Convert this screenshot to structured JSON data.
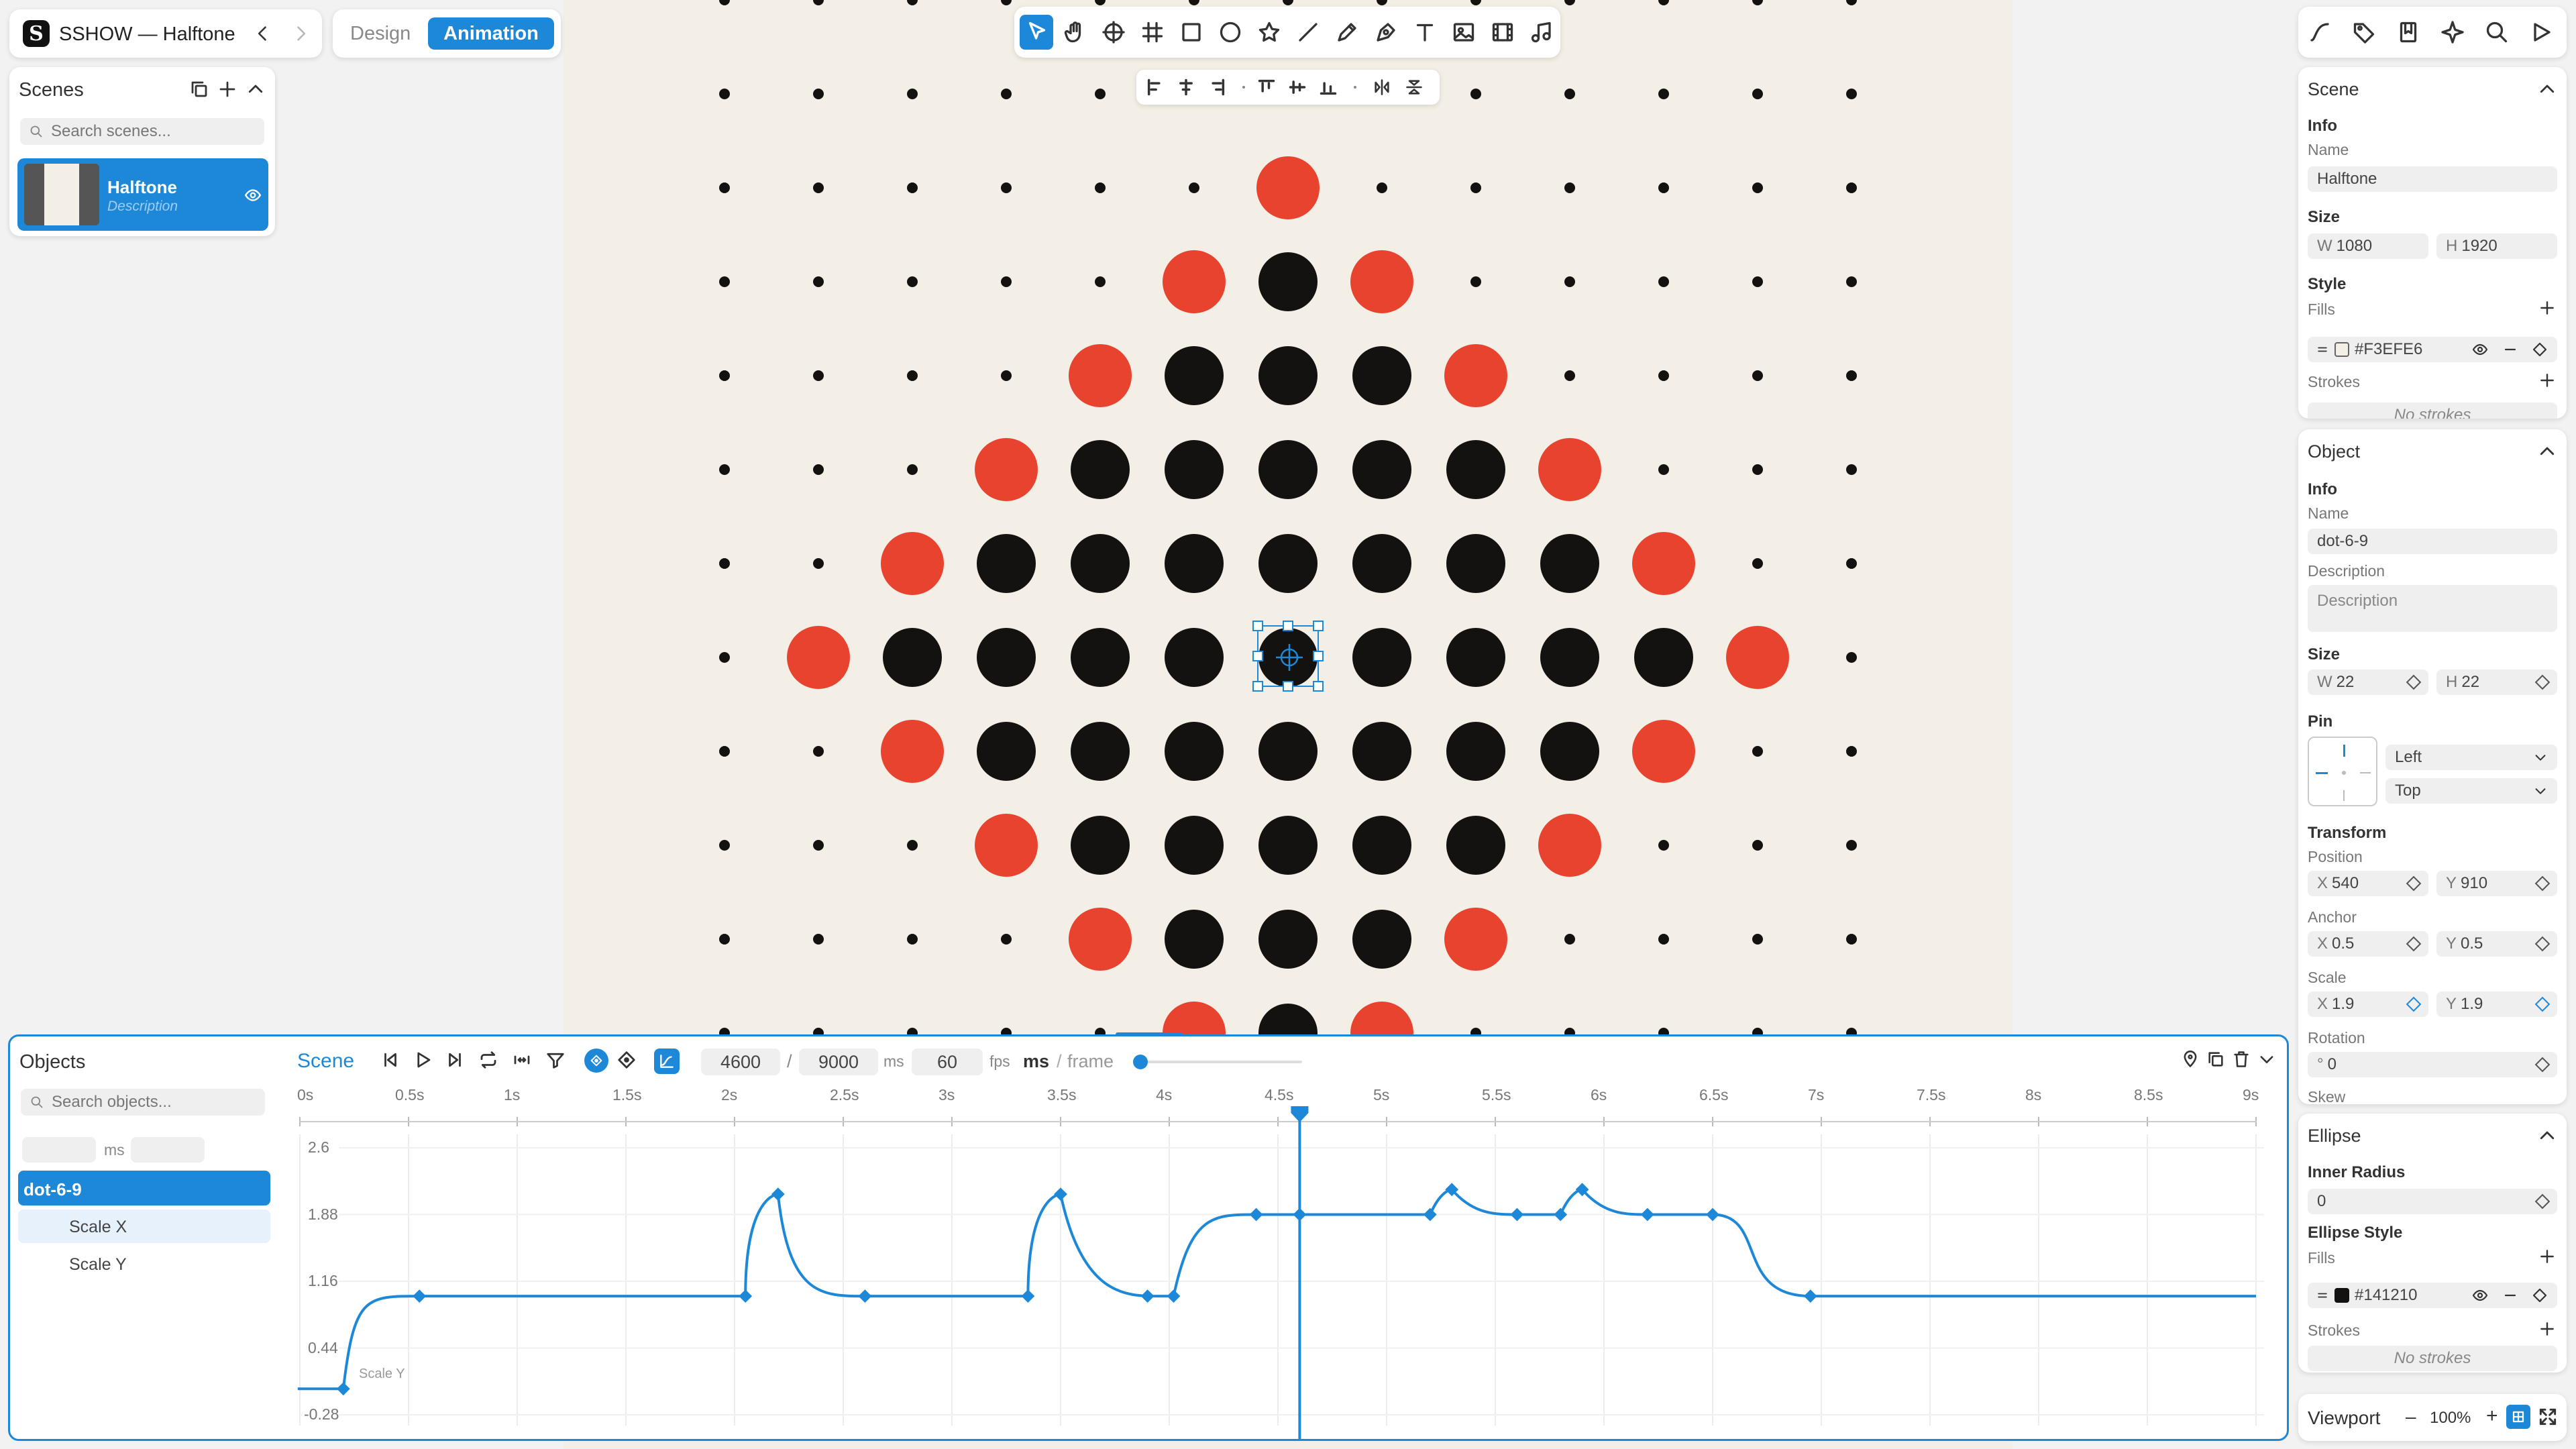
{
  "app": {
    "title": "SSHOW — Halftone"
  },
  "modes": {
    "design": "Design",
    "animation": "Animation"
  },
  "scenes": {
    "title": "Scenes",
    "search_placeholder": "Search scenes...",
    "items": [
      {
        "name": "Halftone",
        "description": "Description"
      }
    ]
  },
  "canvas": {
    "background": "#F3EFE6",
    "red": "#E8432F",
    "black": "#141210"
  },
  "right": {
    "scene": {
      "title": "Scene",
      "info": "Info",
      "name_label": "Name",
      "name": "Halftone",
      "size": "Size",
      "w": "1080",
      "h": "1920",
      "w_pre": "W",
      "h_pre": "H",
      "style": "Style",
      "fills": "Fills",
      "fill_hex": "#F3EFE6",
      "strokes": "Strokes",
      "no_strokes": "No strokes"
    },
    "object": {
      "title": "Object",
      "info": "Info",
      "name_label": "Name",
      "name": "dot-6-9",
      "desc_label": "Description",
      "desc_placeholder": "Description",
      "size": "Size",
      "w": "22",
      "h": "22",
      "pin": "Pin",
      "pin_h": "Left",
      "pin_v": "Top",
      "transform": "Transform",
      "position": "Position",
      "px": "540",
      "py": "910",
      "anchor": "Anchor",
      "ax": "0.5",
      "ay": "0.5",
      "scale": "Scale",
      "sx": "1.9",
      "sy": "1.9",
      "rotation": "Rotation",
      "rot": "0",
      "rot_pre": "°",
      "skew": "Skew",
      "x_pre": "X",
      "y_pre": "Y"
    },
    "ellipse": {
      "title": "Ellipse",
      "inner_radius": "Inner Radius",
      "inner_value": "0",
      "style": "Ellipse Style",
      "fills": "Fills",
      "fill_hex": "#141210",
      "strokes": "Strokes",
      "no_strokes": "No strokes"
    },
    "viewport": {
      "label": "Viewport",
      "zoom": "100%",
      "minus": "–",
      "plus": "+"
    }
  },
  "timeline": {
    "objects_title": "Objects",
    "search_placeholder": "Search objects...",
    "ms_label": "ms",
    "scene_tab": "Scene",
    "current": "4600",
    "total": "9000",
    "unit": "ms",
    "fps": "60",
    "fps_label": "fps",
    "units": "ms",
    "units_alt": "frame",
    "slash": "/",
    "tree": [
      {
        "name": "dot-6-9",
        "selected": true
      },
      {
        "name": "Scale X",
        "selected": false,
        "highlight": true
      },
      {
        "name": "Scale Y",
        "selected": false
      }
    ],
    "ruler": [
      "0s",
      "0.5s",
      "1s",
      "1.5s",
      "2s",
      "2.5s",
      "3s",
      "3.5s",
      "4s",
      "4.5s",
      "5s",
      "5.5s",
      "6s",
      "6.5s",
      "7s",
      "7.5s",
      "8s",
      "8.5s",
      "9s"
    ],
    "y_ticks": [
      "2.6",
      "1.88",
      "1.16",
      "0.44",
      "-0.28"
    ],
    "curve_label": "Scale Y",
    "accent": "#1E88D8"
  }
}
